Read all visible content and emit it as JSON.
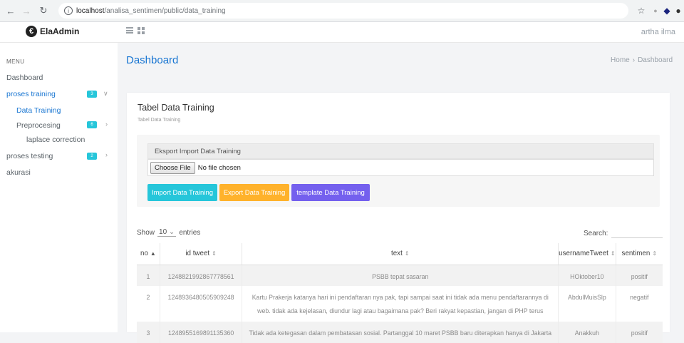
{
  "browser": {
    "url_host": "localhost",
    "url_path": "/analisa_sentimen/public/data_training"
  },
  "app": {
    "logo": "ElaAdmin",
    "user_name": "artha ilma"
  },
  "sidebar": {
    "menu_label": "MENU",
    "items": [
      {
        "label": "Dashboard"
      },
      {
        "label": "proses training",
        "badge": "3"
      },
      {
        "label": "Data Training"
      },
      {
        "label": "Preprocesing",
        "badge": "6"
      },
      {
        "label": "laplace correction"
      },
      {
        "label": "proses testing",
        "badge": "2"
      },
      {
        "label": "akurasi"
      }
    ]
  },
  "header": {
    "title": "Dashboard",
    "breadcrumb": [
      "Home",
      "Dashboard"
    ]
  },
  "card": {
    "title": "Tabel Data Training",
    "subtitle": "Tabel Data Training",
    "import_header": "Eksport Import Data Training",
    "file_button": "Choose File",
    "file_status": "No file chosen",
    "buttons": [
      {
        "label": "Import Data Training",
        "color": "#26c6da"
      },
      {
        "label": "Export Data Training",
        "color": "#ffb22b"
      },
      {
        "label": "template Data Training",
        "color": "#7460ee"
      }
    ]
  },
  "table": {
    "show_label": "Show",
    "entries_value": "10",
    "entries_label": "entries",
    "search_label": "Search:",
    "columns": [
      "no",
      "id tweet",
      "text",
      "usernameTweet",
      "sentimen"
    ],
    "rows": [
      {
        "no": "1",
        "id": "1248821992867778561",
        "text": "PSBB tepat sasaran",
        "user": "HOktober10",
        "sentimen": "positif"
      },
      {
        "no": "2",
        "id": "1248936480505909248",
        "text": "Kartu Prakerja katanya hari ini pendaftaran nya pak, tapi sampai saat ini tidak ada menu pendaftarannya di web. tidak ada kejelasan, diundur lagi atau bagaimana pak? Beri rakyat kepastian, jangan di PHP terus",
        "user": "AbdulMuisSlp",
        "sentimen": "negatif"
      },
      {
        "no": "3",
        "id": "1248955169891135360",
        "text": "Tidak ada ketegasan dalam pembatasan sosial. Partanggal 10 maret PSBB baru diterapkan hanya di Jakarta",
        "user": "Anakkuh",
        "sentimen": "positif"
      }
    ]
  }
}
